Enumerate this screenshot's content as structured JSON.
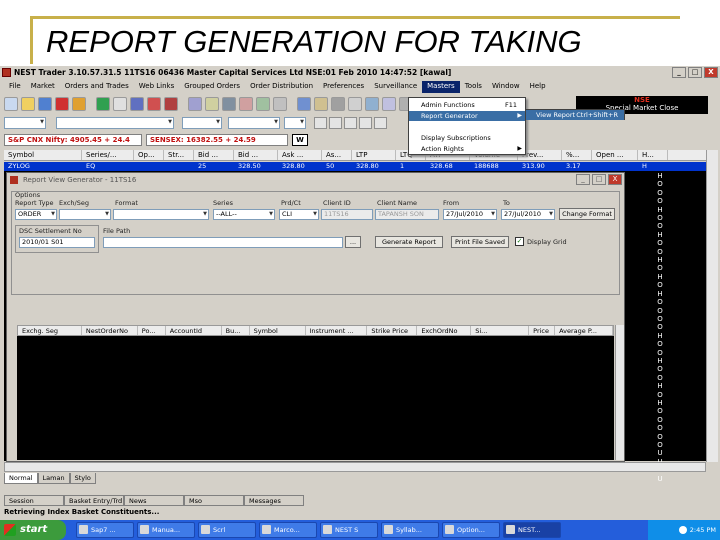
{
  "slide": {
    "title": "REPORT GENERATION FOR TAKING"
  },
  "window": {
    "title": "NEST Trader 3.10.57.31.5 11TS16 06436 Master Capital Services Ltd NSE:01 Feb 2010 14:47:52 [kawal]",
    "min": "_",
    "max": "□",
    "close": "X"
  },
  "menu": [
    "File",
    "Market",
    "Orders and Trades",
    "Web Links",
    "Grouped Orders",
    "Order Distribution",
    "Preferences",
    "Surveillance",
    "Masters",
    "Tools",
    "Window",
    "Help"
  ],
  "dropdown": {
    "items": [
      {
        "label": "Admin Functions",
        "shortcut": "F11"
      },
      {
        "label": "Report Generator"
      },
      {
        "label": "Display Subscriptions"
      },
      {
        "label": "Action Rights"
      }
    ],
    "submenu": {
      "label": "View Report",
      "shortcut": "Ctrl+Shift+R"
    }
  },
  "nse": {
    "label": "NSE",
    "status": "Special Market Close"
  },
  "tickers": {
    "nifty": "S&P CNX Nifty: 4905.45 + 24.4",
    "sensex": "SENSEX: 16382.55 + 24.59",
    "btn": "W"
  },
  "marketwatch": {
    "columns": [
      "Symbol",
      "Series/...",
      "Op...",
      "Str...",
      "Bid ...",
      "Bid ...",
      "Ask ...",
      "As...",
      "LTP",
      "LTQ",
      "ATP",
      "Volume",
      "Prev...",
      "%...",
      "Open ...",
      "H..."
    ],
    "row": [
      "ZYLOG",
      "EQ",
      "",
      "",
      "25",
      "328.50",
      "328.80",
      "50",
      "328.80",
      "1",
      "328.68",
      "188688",
      "313.90",
      "3.17",
      "",
      "",
      "H"
    ]
  },
  "report_dialog": {
    "title": "Report View Generator - 11TS16",
    "btn_min": "_",
    "btn_max": "□",
    "btn_close": "X",
    "options_label": "Options",
    "report_type_label": "Report Type",
    "exchseg_label": "Exch/Seg",
    "format_label": "Format",
    "series_label": "Series",
    "product_label": "Prd/Ct",
    "client_id_label": "Client ID",
    "client_name_label": "Client Name",
    "from_label": "From",
    "to_label": "To",
    "report_type": "ORDER",
    "series": "--ALL--",
    "product": "CLI",
    "client_id": "11TS16",
    "client_name": "TAPANSH SON",
    "from": "27/Jul/2010",
    "to": "27/Jul/2010",
    "change_format": "Change Format",
    "dsc_label": "DSC Settlement No",
    "file_path_label": "File Path",
    "dsc_value": "2010/01 S01",
    "browse": "...",
    "generate": "Generate Report",
    "print": "Print File Saved",
    "display_grid": "Display Grid",
    "check": "✓",
    "columns": [
      "Exchg. Seg",
      "NestOrderNo",
      "Po...",
      "AccountId",
      "Bu...",
      "Symbol",
      "Instrument ...",
      "Strike Price",
      "ExchOrdNo",
      "Si...",
      "Price",
      "Average P..."
    ]
  },
  "o_column": [
    "H",
    "O",
    "O",
    "O",
    "H",
    "O",
    "O",
    "H",
    "O",
    "O",
    "H",
    "O",
    "H",
    "O",
    "H",
    "O",
    "O",
    "O",
    "O",
    "H",
    "O",
    "O",
    "H",
    "O",
    "O",
    "H",
    "O",
    "H",
    "O",
    "O",
    "O",
    "O",
    "O",
    "U",
    "U",
    "U",
    "U"
  ],
  "tabs": [
    "Normal",
    "Laman",
    "Stylo"
  ],
  "panels": [
    "Session",
    "Basket Entry/Trd",
    "News",
    "Mso",
    "Messages"
  ],
  "status": "Retrieving Index Basket Constituents...",
  "taskbar": {
    "start": "start",
    "tasks": [
      "Sap7 ...",
      "Manua...",
      "Scrl",
      "Marco...",
      "NEST S",
      "Syllab...",
      "Option...",
      "NEST..."
    ],
    "clock": "2:45 PM"
  }
}
